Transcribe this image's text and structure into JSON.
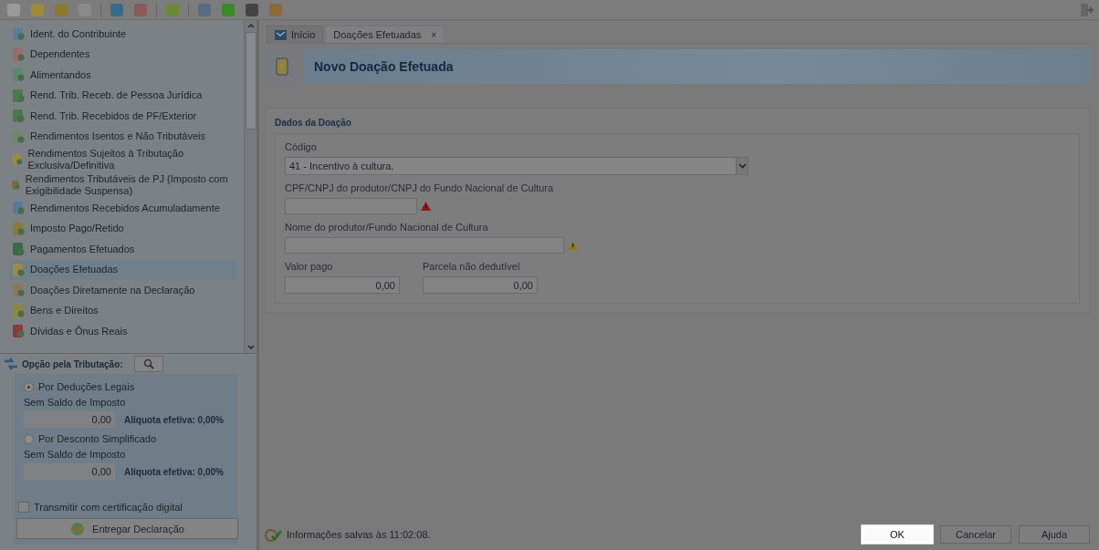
{
  "tabs": [
    {
      "label": "Início",
      "selected": false,
      "icon": true
    },
    {
      "label": "Doações Efetuadas",
      "selected": true,
      "close": "×"
    }
  ],
  "sidebar": {
    "items": [
      {
        "label": "Ident. do Contribuinte",
        "selected": false
      },
      {
        "label": "Dependentes",
        "selected": false
      },
      {
        "label": "Alimentandos",
        "selected": false
      },
      {
        "label": "Rend. Trib. Receb. de Pessoa Jurídica",
        "selected": false
      },
      {
        "label": "Rend. Trib. Recebidos de PF/Exterior",
        "selected": false
      },
      {
        "label": "Rendimentos Isentos e Não Tributáveis",
        "selected": false
      },
      {
        "label": "Rendimentos Sujeitos à Tributação Exclusiva/Definitiva",
        "selected": false
      },
      {
        "label": "Rendimentos Tributáveis de PJ (Imposto com Exigibilidade Suspensa)",
        "selected": false
      },
      {
        "label": "Rendimentos Recebidos Acumuladamente",
        "selected": false
      },
      {
        "label": "Imposto Pago/Retido",
        "selected": false
      },
      {
        "label": "Pagamentos Efetuados",
        "selected": false
      },
      {
        "label": "Doações Efetuadas",
        "selected": true
      },
      {
        "label": "Doações Diretamente na Declaração",
        "selected": false
      },
      {
        "label": "Bens e Direitos",
        "selected": false
      },
      {
        "label": "Dívidas e Ônus Reais",
        "selected": false
      }
    ]
  },
  "tax_option": {
    "title": "Opção pela Tributação:",
    "options": [
      {
        "label": "Por Deduções Legais",
        "selected": true,
        "subtitle": "Sem Saldo de Imposto",
        "value": "0,00",
        "rate": "Alíquota efetiva: 0,00%"
      },
      {
        "label": "Por Desconto Simplificado",
        "selected": false,
        "subtitle": "Sem Saldo de Imposto",
        "value": "0,00",
        "rate": "Alíquota efetiva: 0,00%"
      }
    ],
    "certificate": {
      "label": "Transmitir com certificação digital",
      "checked": false
    },
    "deliver_button": "Entregar Declaração"
  },
  "header": {
    "title": "Novo Doação Efetuada"
  },
  "section": {
    "title": "Dados da Doação",
    "code": {
      "label": "Código",
      "value": "41 - Incentivo à cultura."
    },
    "fields": [
      {
        "label": "CPF/CNPJ do produtor/CNPJ do Fundo Nacional de Cultura",
        "kind": "error"
      },
      {
        "label": "Nome do produtor/Fundo Nacional de Cultura",
        "kind": "warning"
      }
    ],
    "amounts": [
      {
        "label": "Valor pago",
        "value": "0,00"
      },
      {
        "label": "Parcela não dedutível",
        "value": "0,00"
      }
    ]
  },
  "status_bar": {
    "text": "Informações salvas às 11:02:08."
  },
  "buttons": [
    {
      "label": "OK",
      "highlighted": true
    },
    {
      "label": "Cancelar",
      "highlighted": false
    },
    {
      "label": "Ajuda",
      "highlighted": false
    }
  ]
}
